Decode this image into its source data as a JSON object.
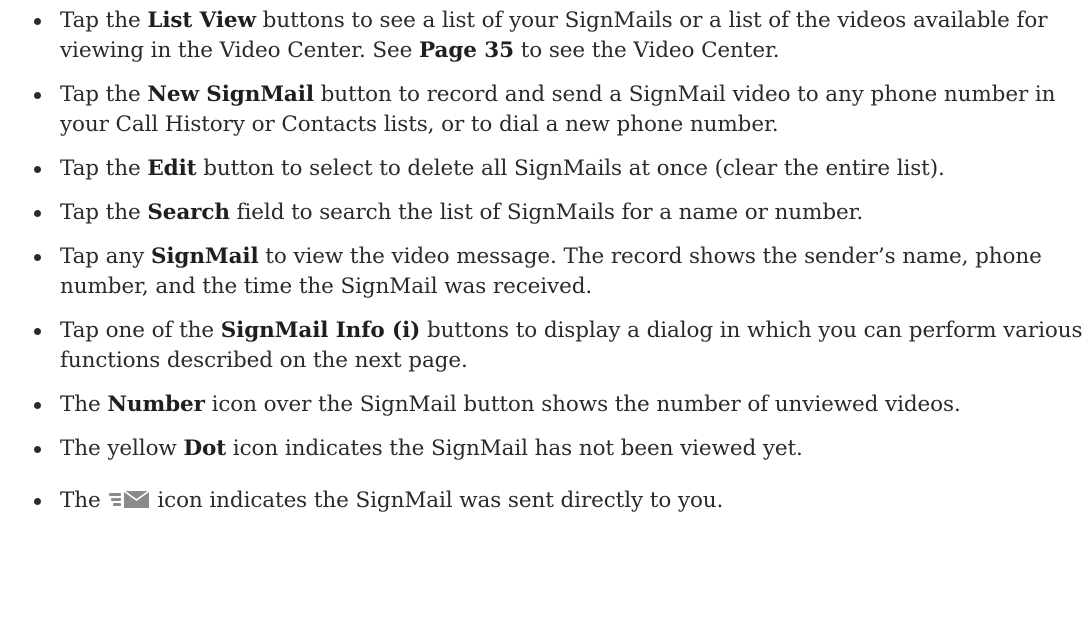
{
  "bullets": [
    {
      "pre": "Tap the ",
      "bold": "List View",
      "mid": " buttons to see a list of your SignMails or a list of the videos available for viewing in the Video Center. See ",
      "bold2": "Page 35",
      "post": " to see the Video Center."
    },
    {
      "pre": "Tap the ",
      "bold": "New SignMail",
      "post": " button to record and send a SignMail video to any phone number in your Call History or Contacts lists, or to dial a new phone number."
    },
    {
      "pre": "Tap the ",
      "bold": "Edit",
      "post": " button to select to delete all SignMails at once (clear the entire list)."
    },
    {
      "pre": "Tap the ",
      "bold": "Search",
      "post": " field to search the list of SignMails for a name or number."
    },
    {
      "pre": "Tap any ",
      "bold": "SignMail",
      "post": " to view the video message. The record shows the sender’s name, phone number, and the time the SignMail was received."
    },
    {
      "pre": "Tap one of the ",
      "bold": "SignMail Info (i)",
      "post": " buttons to display a dialog in which you can perform various functions described on the next page."
    },
    {
      "pre": "The ",
      "bold": "Number",
      "post": " icon over the SignMail button shows the number of unviewed videos."
    },
    {
      "pre": "The yellow ",
      "bold": "Dot",
      "post": " icon indicates the SignMail has not been viewed yet."
    },
    {
      "pre": "The ",
      "icon": "signmail-direct-icon",
      "post": "icon indicates the SignMail was sent directly to you."
    }
  ],
  "colors": {
    "text": "#2a2a2a",
    "icon": "#8a8a8a"
  }
}
